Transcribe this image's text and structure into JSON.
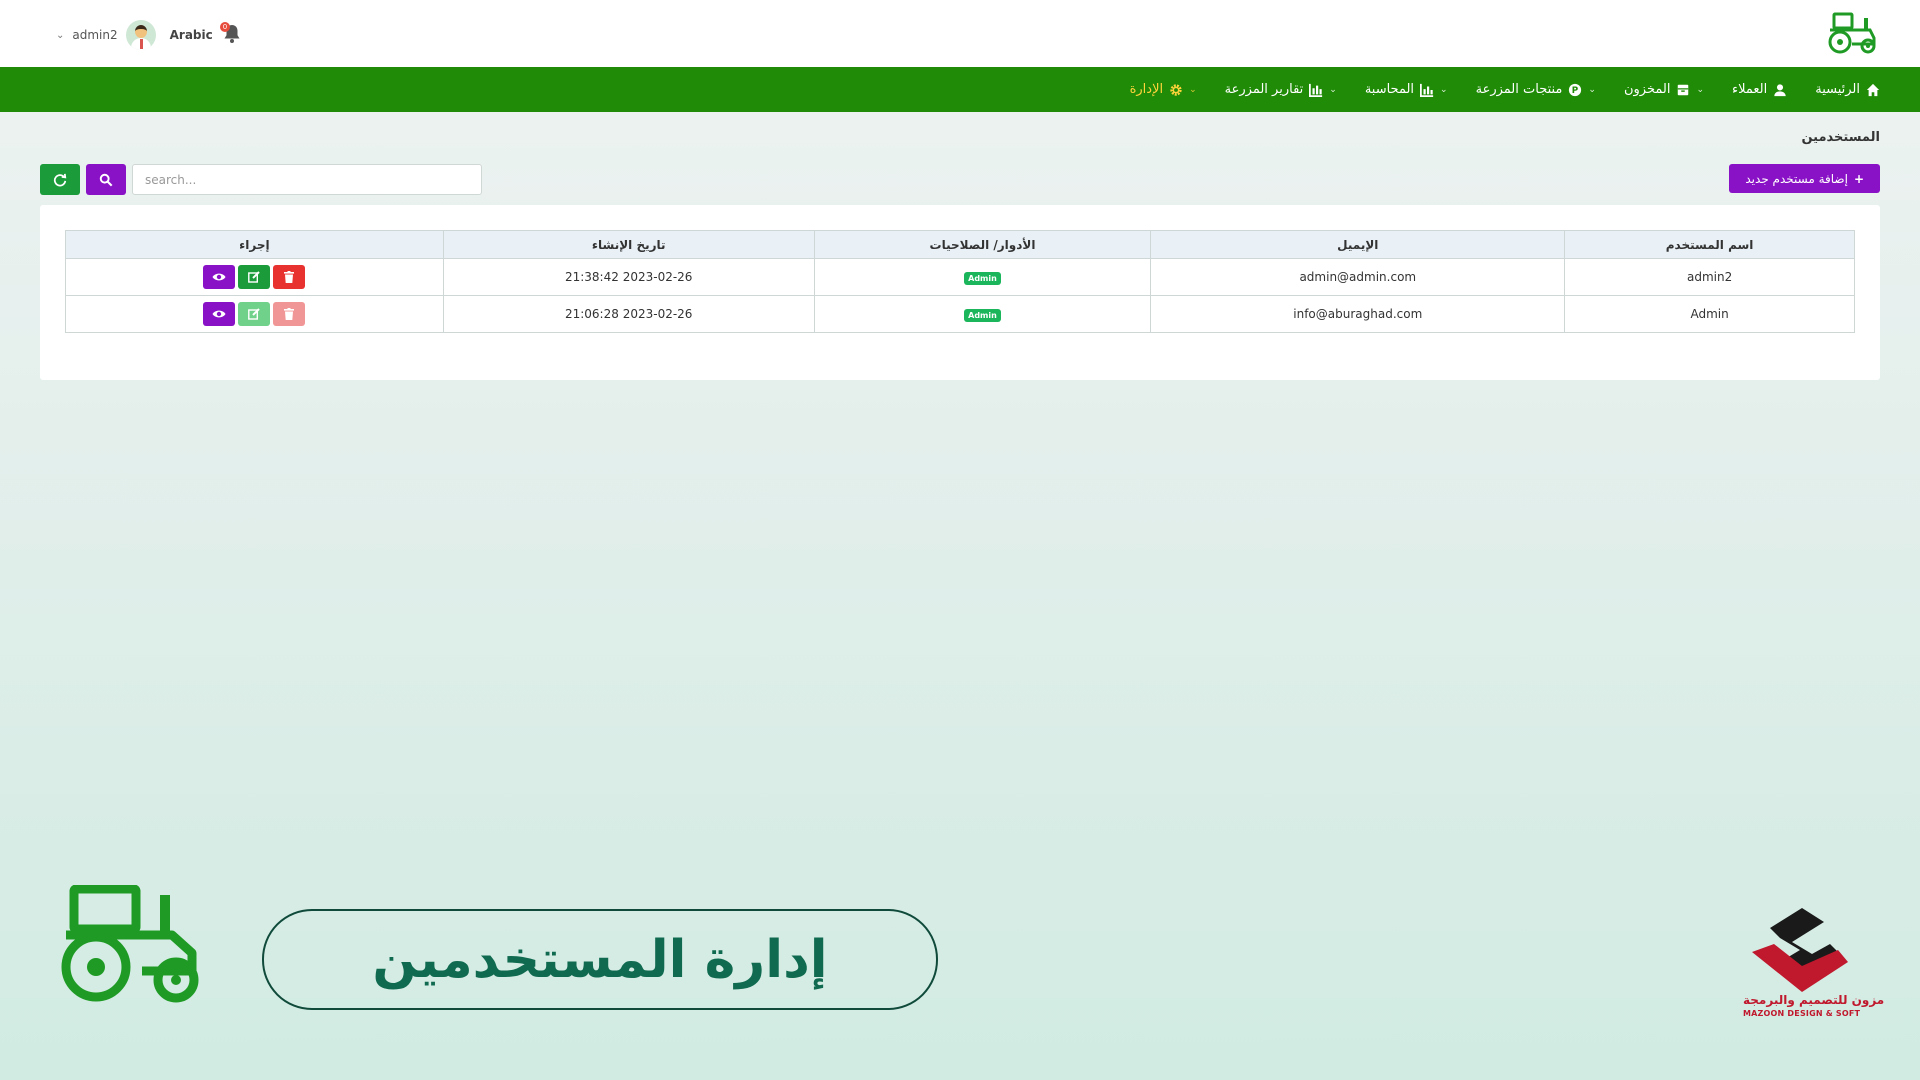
{
  "header": {
    "username": "admin2",
    "language": "Arabic",
    "notification_count": "0"
  },
  "nav": {
    "items": [
      {
        "label": "الرئيسية",
        "icon": "home-icon"
      },
      {
        "label": "العملاء",
        "icon": "user-icon"
      },
      {
        "label": "المخزون",
        "icon": "box-icon"
      },
      {
        "label": "منتجات المزرعة",
        "icon": "product-icon"
      },
      {
        "label": "المحاسبة",
        "icon": "chart-icon"
      },
      {
        "label": "تقارير المزرعة",
        "icon": "report-icon"
      },
      {
        "label": "الإدارة",
        "icon": "gear-icon"
      }
    ]
  },
  "page": {
    "title": "المستخدمين",
    "add_button": "إضافة مستخدم جديد",
    "search_placeholder": "search..."
  },
  "table": {
    "headers": [
      "اسم المستخدم",
      "الإيميل",
      "الأدوار/ الصلاحيات",
      "تاريخ الإنشاء",
      "إجراء"
    ],
    "rows": [
      {
        "name": "admin2",
        "email": "admin@admin.com",
        "role": "Admin",
        "created": "2023-02-26 21:38:42"
      },
      {
        "name": "Admin",
        "email": "info@aburaghad.com",
        "role": "Admin",
        "created": "2023-02-26 21:06:28"
      }
    ]
  },
  "footer": {
    "banner_title": "إدارة المستخدمين",
    "brand_ar": "مزون للتصميم والبرمجة",
    "brand_en": "MAZOON DESIGN & SOFT"
  },
  "colors": {
    "nav_green": "#1f8b07",
    "accent_purple": "#8a12c6",
    "action_green": "#1c9b3a",
    "danger_red": "#e8322f",
    "badge_green": "#1bb55c"
  }
}
